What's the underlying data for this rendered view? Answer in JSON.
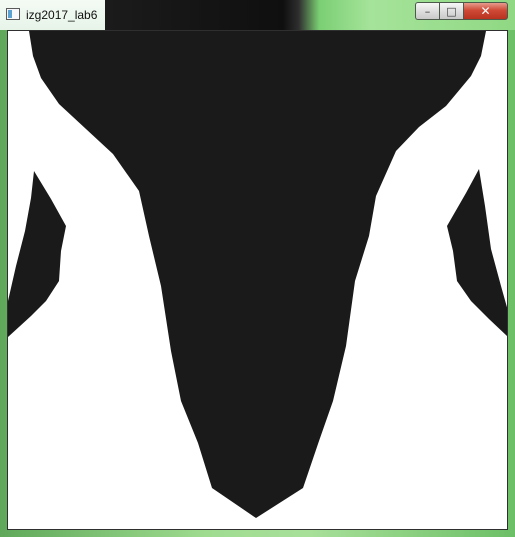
{
  "window": {
    "title": "izg2017_lab6",
    "controls": {
      "minimize_glyph": "–",
      "maximize_glyph": "□",
      "close_glyph": "✕"
    }
  },
  "canvas": {
    "background_color": "#ffffff",
    "shape_color": "#1a1a1a"
  },
  "colors": {
    "frame_accent": "#8fd884",
    "close_button": "#cf4a36"
  }
}
